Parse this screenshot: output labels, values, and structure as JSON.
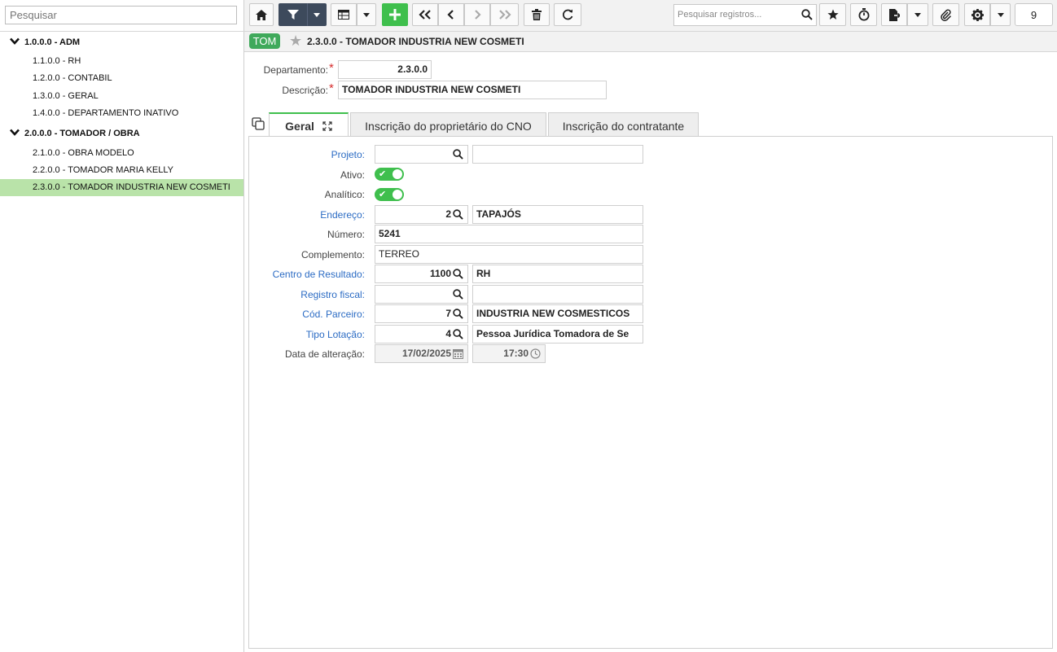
{
  "sidebar": {
    "search_placeholder": "Pesquisar",
    "items": [
      {
        "label": "1.0.0.0 - ADM",
        "type": "group"
      },
      {
        "label": "1.1.0.0 - RH",
        "type": "leaf"
      },
      {
        "label": "1.2.0.0 - CONTABIL",
        "type": "leaf"
      },
      {
        "label": "1.3.0.0 - GERAL",
        "type": "leaf"
      },
      {
        "label": "1.4.0.0 - DEPARTAMENTO INATIVO",
        "type": "leaf"
      },
      {
        "label": "2.0.0.0 - TOMADOR / OBRA",
        "type": "group"
      },
      {
        "label": "2.1.0.0 - OBRA MODELO",
        "type": "leaf"
      },
      {
        "label": "2.2.0.0 - TOMADOR MARIA KELLY",
        "type": "leaf"
      },
      {
        "label": "2.3.0.0 - TOMADOR INDUSTRIA NEW COSMETI",
        "type": "leaf",
        "selected": true
      }
    ]
  },
  "toolbar": {
    "search_placeholder": "Pesquisar registros...",
    "counter": "9",
    "icons": [
      "home-icon",
      "filter-icon",
      "caret-down-icon",
      "table-icon",
      "caret-down-icon",
      "plus-icon",
      "first-icon",
      "prev-icon",
      "next-icon",
      "last-icon",
      "trash-icon",
      "refresh-icon",
      "star-icon",
      "stopwatch-icon",
      "export-icon",
      "caret-down-icon",
      "paperclip-icon",
      "gear-icon",
      "caret-down-icon"
    ],
    "colors": {
      "dark": "#3d4a5c",
      "add": "#3fbf4d"
    }
  },
  "record": {
    "tag": "TOM",
    "title": "2.3.0.0 - TOMADOR INDUSTRIA NEW COSMETI"
  },
  "header_form": {
    "departamento_label": "Departamento:",
    "departamento_value": "2.3.0.0",
    "descricao_label": "Descrição:",
    "descricao_value": "TOMADOR INDUSTRIA NEW COSMETI",
    "required_mark": "*"
  },
  "tabs": [
    {
      "label": "Geral",
      "active": true
    },
    {
      "label": "Inscrição do proprietário do CNO",
      "active": false
    },
    {
      "label": "Inscrição do contratante",
      "active": false
    }
  ],
  "geral": {
    "projeto": {
      "label": "Projeto:",
      "code": "",
      "desc": ""
    },
    "ativo": {
      "label": "Ativo:",
      "value": true
    },
    "analitico": {
      "label": "Analítico:",
      "value": true
    },
    "endereco": {
      "label": "Endereço:",
      "code": "2",
      "desc": "TAPAJÓS"
    },
    "numero": {
      "label": "Número:",
      "value": "5241"
    },
    "complemento": {
      "label": "Complemento:",
      "value": "TERREO"
    },
    "centro": {
      "label": "Centro de Resultado:",
      "code": "1100",
      "desc": "RH"
    },
    "registro": {
      "label": "Registro fiscal:",
      "code": "",
      "desc": ""
    },
    "parceiro": {
      "label": "Cód. Parceiro:",
      "code": "7",
      "desc": "INDUSTRIA NEW COSMESTICOS"
    },
    "lotacao": {
      "label": "Tipo Lotação:",
      "code": "4",
      "desc": "Pessoa Jurídica Tomadora de Se"
    },
    "alteracao": {
      "label": "Data de alteração:",
      "date": "17/02/2025",
      "time": "17:30"
    }
  }
}
